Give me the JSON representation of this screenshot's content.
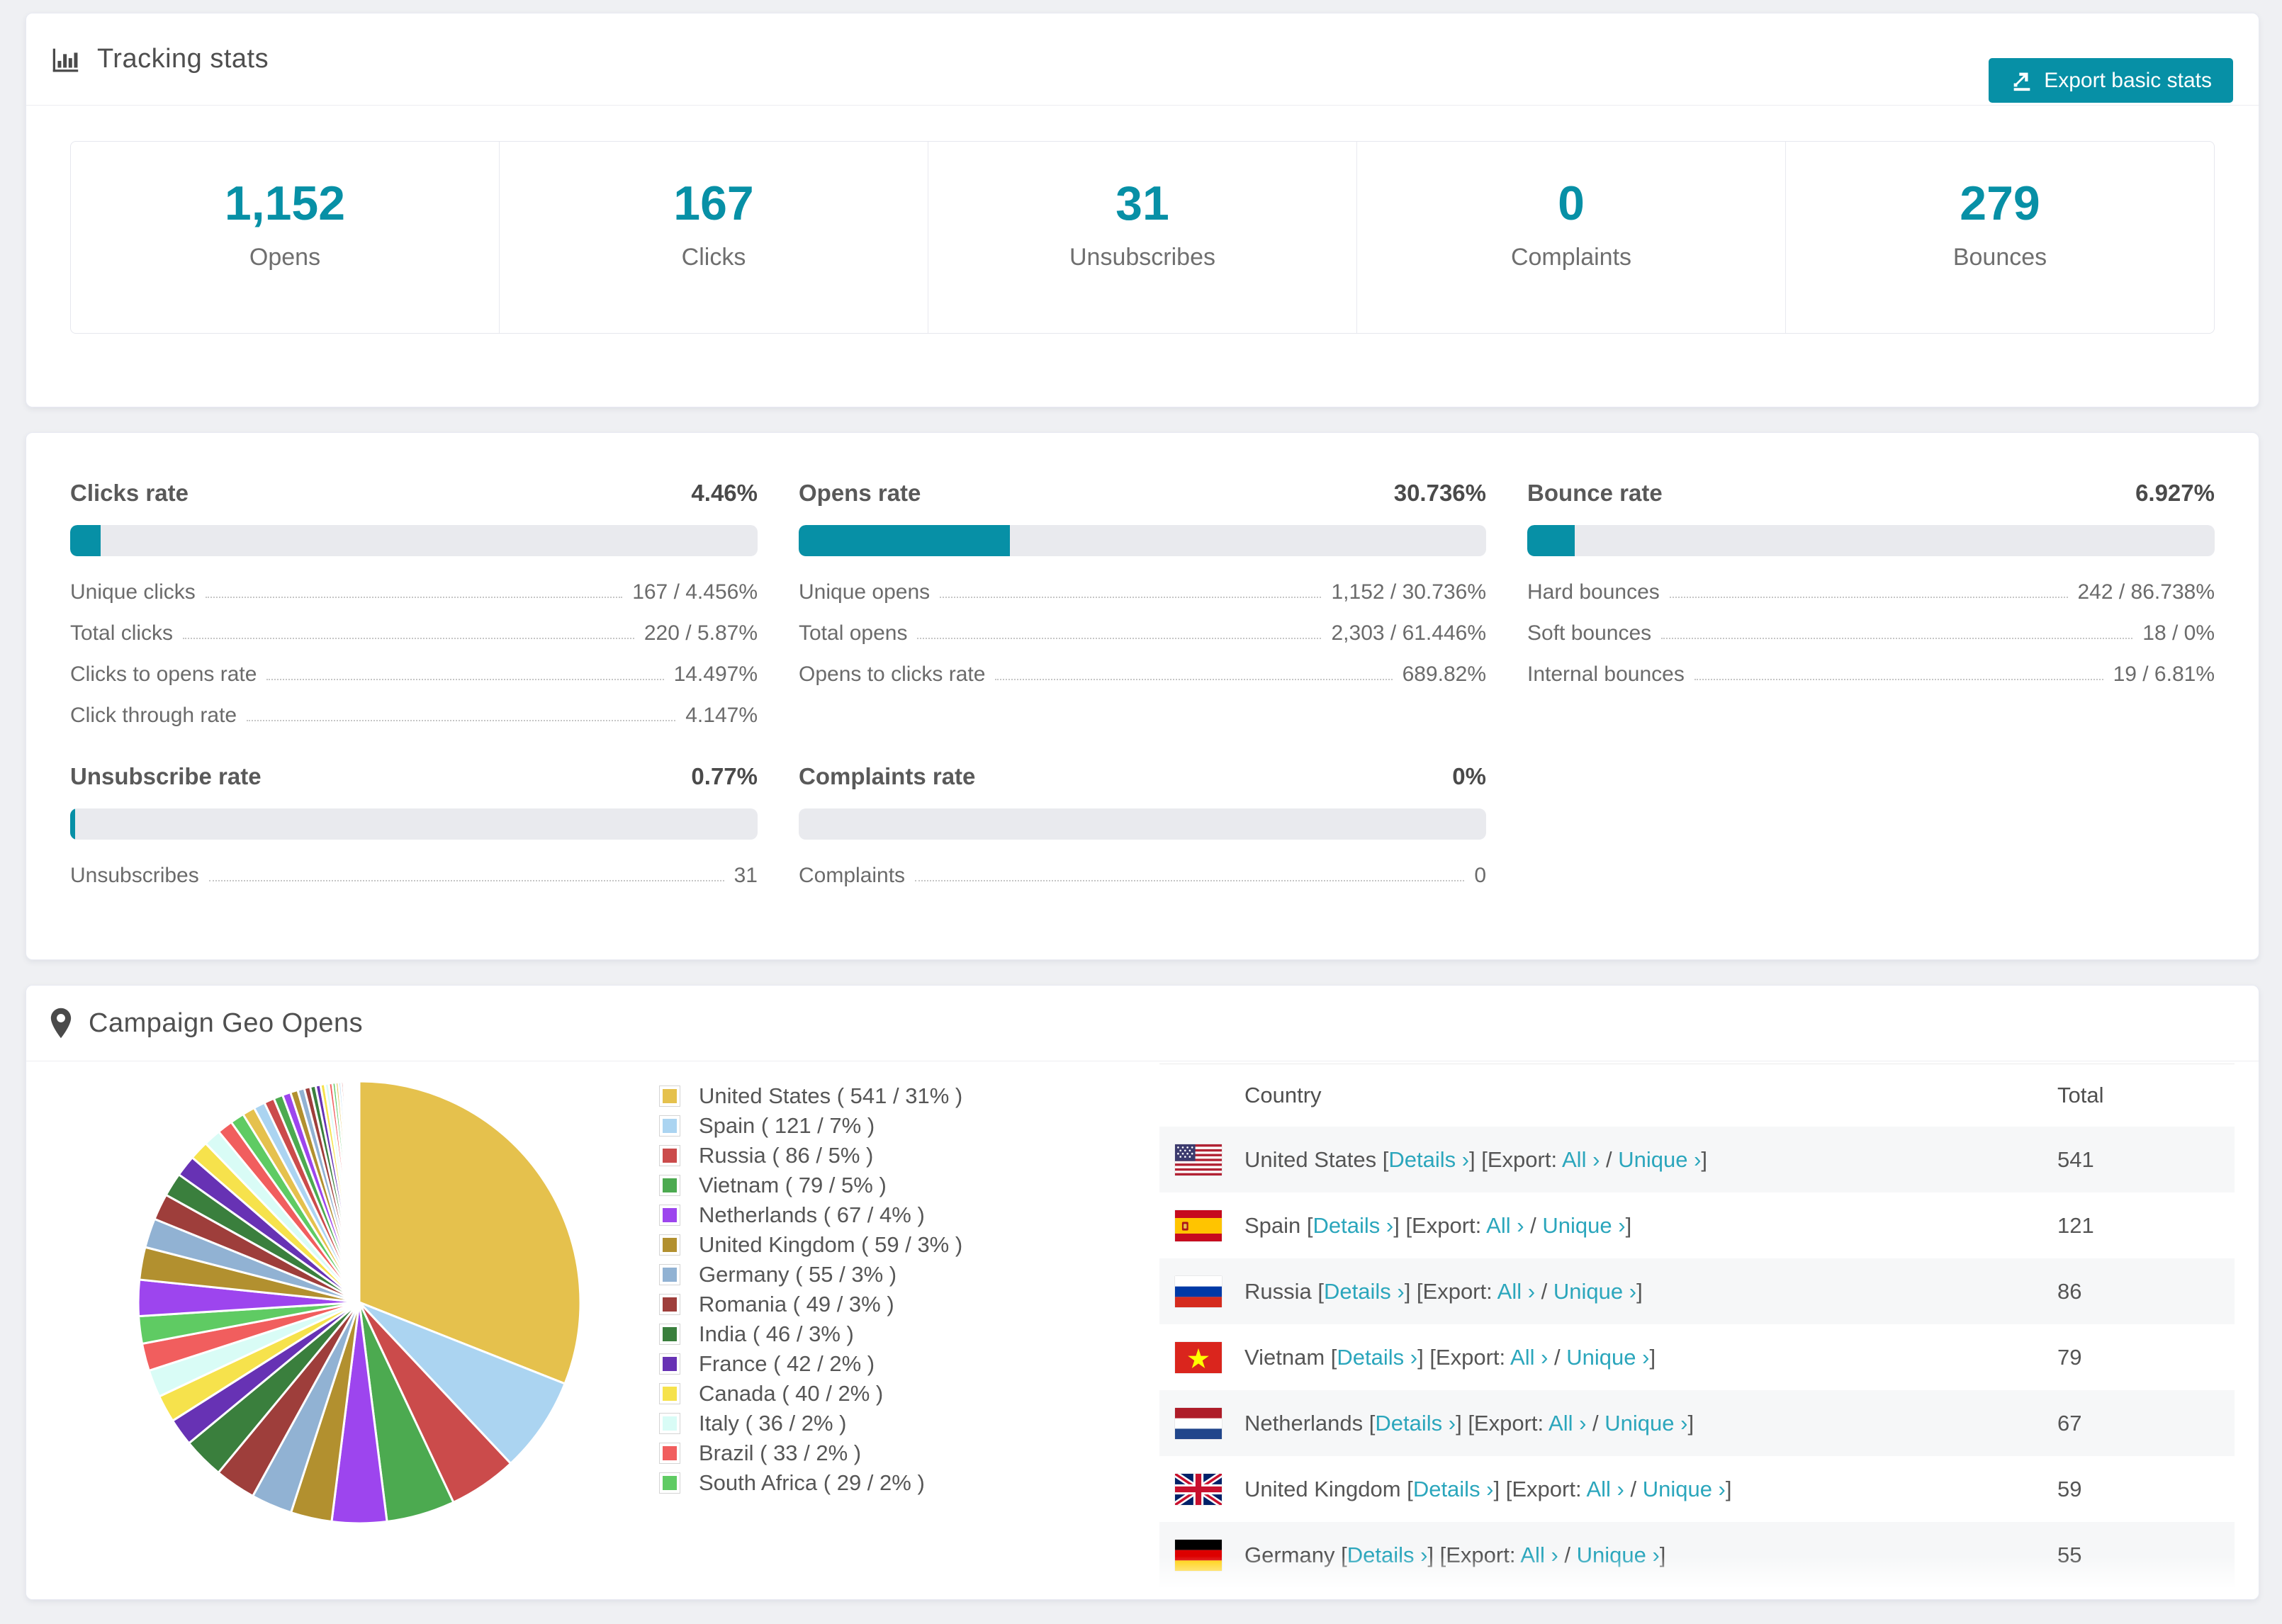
{
  "colors": {
    "accent": "#0790A6",
    "link": "#2BA6BC",
    "bar_track": "#E9EAEE"
  },
  "tracking_card": {
    "title": "Tracking stats",
    "export_button": "Export basic stats",
    "stats": [
      {
        "value": "1,152",
        "label": "Opens"
      },
      {
        "value": "167",
        "label": "Clicks"
      },
      {
        "value": "31",
        "label": "Unsubscribes"
      },
      {
        "value": "0",
        "label": "Complaints"
      },
      {
        "value": "279",
        "label": "Bounces"
      }
    ]
  },
  "rates_card": {
    "blocks": [
      {
        "title": "Clicks rate",
        "value": "4.46%",
        "percent": 4.46,
        "rows": [
          {
            "label": "Unique clicks",
            "value": "167 / 4.456%"
          },
          {
            "label": "Total clicks",
            "value": "220 / 5.87%"
          },
          {
            "label": "Clicks to opens rate",
            "value": "14.497%"
          },
          {
            "label": "Click through rate",
            "value": "4.147%"
          }
        ]
      },
      {
        "title": "Opens rate",
        "value": "30.736%",
        "percent": 30.736,
        "rows": [
          {
            "label": "Unique opens",
            "value": "1,152 / 30.736%"
          },
          {
            "label": "Total opens",
            "value": "2,303 / 61.446%"
          },
          {
            "label": "Opens to clicks rate",
            "value": "689.82%"
          }
        ]
      },
      {
        "title": "Bounce rate",
        "value": "6.927%",
        "percent": 6.927,
        "rows": [
          {
            "label": "Hard bounces",
            "value": "242 / 86.738%"
          },
          {
            "label": "Soft bounces",
            "value": "18 / 0%"
          },
          {
            "label": "Internal bounces",
            "value": "19 / 6.81%"
          }
        ]
      },
      {
        "title": "Unsubscribe rate",
        "value": "0.77%",
        "percent": 0.77,
        "rows": [
          {
            "label": "Unsubscribes",
            "value": "31"
          }
        ]
      },
      {
        "title": "Complaints rate",
        "value": "0%",
        "percent": 0,
        "rows": [
          {
            "label": "Complaints",
            "value": "0"
          }
        ]
      }
    ]
  },
  "geo_card": {
    "title": "Campaign Geo Opens",
    "legend": [
      {
        "label": "United States ( 541 / 31% )",
        "color": "#E5C14D"
      },
      {
        "label": "Spain ( 121 / 7% )",
        "color": "#ABD4F1"
      },
      {
        "label": "Russia ( 86 / 5% )",
        "color": "#CB4B4B"
      },
      {
        "label": "Vietnam ( 79 / 5% )",
        "color": "#4CAA50"
      },
      {
        "label": "Netherlands ( 67 / 4% )",
        "color": "#9D45EE"
      },
      {
        "label": "United Kingdom ( 59 / 3% )",
        "color": "#B2902F"
      },
      {
        "label": "Germany ( 55 / 3% )",
        "color": "#91B2D3"
      },
      {
        "label": "Romania ( 49 / 3% )",
        "color": "#9E3E3B"
      },
      {
        "label": "India ( 46 / 3% )",
        "color": "#3A7F3D"
      },
      {
        "label": "France ( 42 / 2% )",
        "color": "#6732B4"
      },
      {
        "label": "Canada ( 40 / 2% )",
        "color": "#F6E24C"
      },
      {
        "label": "Italy ( 36 / 2% )",
        "color": "#D9FCF6"
      },
      {
        "label": "Brazil ( 33 / 2% )",
        "color": "#F15E5E"
      },
      {
        "label": "South Africa ( 29 / 2% )",
        "color": "#5FCB63"
      }
    ],
    "chart_data": {
      "type": "pie",
      "title": "Campaign Geo Opens",
      "legend_position": "right",
      "labels": [
        "United States",
        "Spain",
        "Russia",
        "Vietnam",
        "Netherlands",
        "United Kingdom",
        "Germany",
        "Romania",
        "India",
        "France",
        "Canada",
        "Italy",
        "Brazil",
        "South Africa"
      ],
      "counts": [
        541,
        121,
        86,
        79,
        67,
        59,
        55,
        49,
        46,
        42,
        40,
        36,
        33,
        29
      ],
      "values": [
        31,
        7,
        5,
        5,
        4,
        3,
        3,
        3,
        3,
        2,
        2,
        2,
        2,
        2
      ],
      "others_percent": 26,
      "palette": [
        "#E5C14D",
        "#ABD4F1",
        "#CB4B4B",
        "#4CAA50",
        "#9D45EE",
        "#B2902F",
        "#91B2D3",
        "#9E3E3B",
        "#3A7F3D",
        "#6732B4",
        "#F6E24C",
        "#D9FCF6",
        "#F15E5E",
        "#5FCB63"
      ]
    },
    "table": {
      "columns": [
        "Country",
        "Total"
      ],
      "links": {
        "bracket_open": "[",
        "bracket_close": "]",
        "details": "Details",
        "export": "[Export:",
        "all": "All",
        "slash": "/",
        "unique": "Unique",
        "chevron": "›"
      },
      "rows": [
        {
          "country": "United States",
          "flag": "us",
          "total": "541"
        },
        {
          "country": "Spain",
          "flag": "es",
          "total": "121"
        },
        {
          "country": "Russia",
          "flag": "ru",
          "total": "86"
        },
        {
          "country": "Vietnam",
          "flag": "vn",
          "total": "79"
        },
        {
          "country": "Netherlands",
          "flag": "nl",
          "total": "67"
        },
        {
          "country": "United Kingdom",
          "flag": "gb",
          "total": "59"
        },
        {
          "country": "Germany",
          "flag": "de",
          "total": "55"
        }
      ]
    }
  }
}
